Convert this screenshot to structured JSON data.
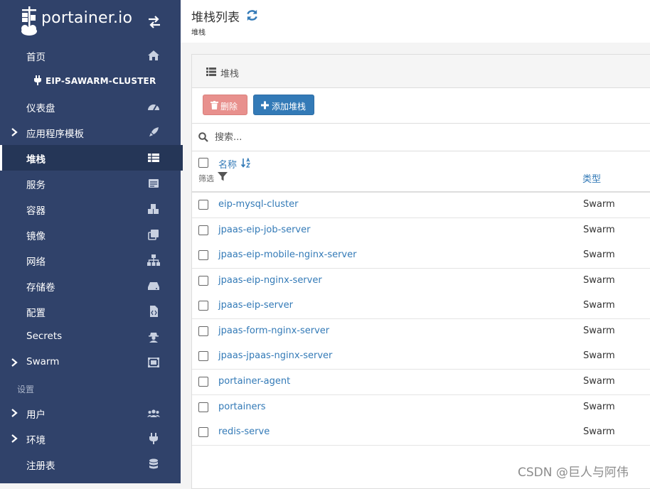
{
  "app": {
    "logo_text": "portainer.io"
  },
  "sidebar": {
    "home": "首页",
    "cluster": "EIP-SAWARM-CLUSTER",
    "items": [
      {
        "label": "仪表盘",
        "icon": "dashboard-icon"
      },
      {
        "label": "应用程序模板",
        "icon": "rocket-icon"
      },
      {
        "label": "堆栈",
        "icon": "table-icon"
      },
      {
        "label": "服务",
        "icon": "list-icon"
      },
      {
        "label": "容器",
        "icon": "cubes-icon"
      },
      {
        "label": "镜像",
        "icon": "clone-icon"
      },
      {
        "label": "网络",
        "icon": "sitemap-icon"
      },
      {
        "label": "存储卷",
        "icon": "hdd-icon"
      },
      {
        "label": "配置",
        "icon": "file-code-icon"
      },
      {
        "label": "Secrets",
        "icon": "user-secret-icon"
      },
      {
        "label": "Swarm",
        "icon": "object-group-icon"
      }
    ],
    "settings_section": "设置",
    "settings_items": [
      {
        "label": "用户",
        "icon": "users-icon"
      },
      {
        "label": "环境",
        "icon": "plug-icon"
      },
      {
        "label": "注册表",
        "icon": "database-icon"
      }
    ],
    "active": "堆栈"
  },
  "header": {
    "title": "堆栈列表",
    "breadcrumb": "堆栈"
  },
  "panel": {
    "title": "堆栈",
    "delete_label": "删除",
    "add_label": "添加堆栈",
    "search_placeholder": "搜索..."
  },
  "table": {
    "col_name": "名称",
    "filter_label": "筛选",
    "col_type": "类型",
    "rows": [
      {
        "name": "eip-mysql-cluster",
        "type": "Swarm"
      },
      {
        "name": "jpaas-eip-job-server",
        "type": "Swarm"
      },
      {
        "name": "jpaas-eip-mobile-nginx-server",
        "type": "Swarm"
      },
      {
        "name": "jpaas-eip-nginx-server",
        "type": "Swarm"
      },
      {
        "name": "jpaas-eip-server",
        "type": "Swarm"
      },
      {
        "name": "jpaas-form-nginx-server",
        "type": "Swarm"
      },
      {
        "name": "jpaas-jpaas-nginx-server",
        "type": "Swarm"
      },
      {
        "name": "portainer-agent",
        "type": "Swarm"
      },
      {
        "name": "portainers",
        "type": "Swarm"
      },
      {
        "name": "redis-serve",
        "type": "Swarm"
      }
    ]
  },
  "watermark": "CSDN @巨人与阿伟",
  "colors": {
    "sidebar": "#30426a",
    "link": "#337ab7",
    "danger": "#e8908d",
    "primary": "#337ab7"
  }
}
